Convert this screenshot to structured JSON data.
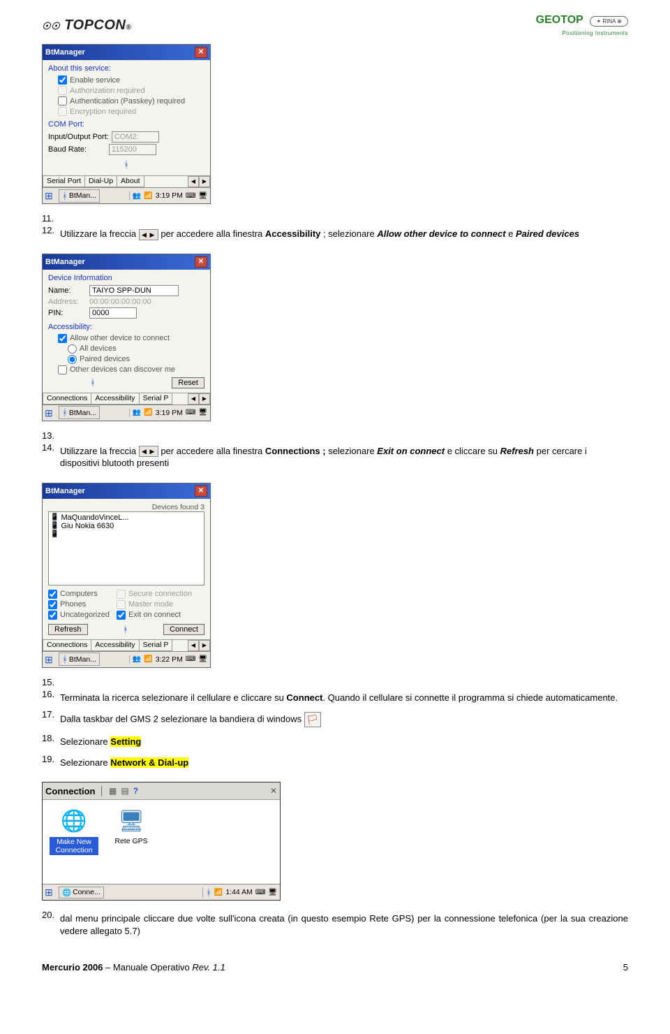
{
  "header": {
    "left_logo": "TOPCON",
    "right_logo": "GEOTOP",
    "right_sub": "Positioning Instruments",
    "cert": "RINA"
  },
  "step11": {
    "num": "11.",
    "dialog": {
      "title": "BtManager",
      "section": "About this service:",
      "chk_enable": "Enable service",
      "chk_auth_req": "Authorization required",
      "chk_passkey": "Authentication (Passkey) required",
      "chk_encrypt": "Encryption required",
      "com_port": "COM Port:",
      "io_port_label": "Input/Output Port:",
      "io_port_val": "COM2:",
      "baud_label": "Baud Rate:",
      "baud_val": "115200",
      "tab1": "Serial Port",
      "tab2": "Dial-Up",
      "tab3": "About",
      "task_btman": "BtMan...",
      "time": "3:19 PM"
    }
  },
  "step12": {
    "num": "12.",
    "text_a": "Utilizzare la freccia ",
    "text_b": " per accedere alla finestra ",
    "bold1": "Accessibility",
    "text_c": " ; selezionare ",
    "ital1": "Allow other device to connect",
    "text_d": " e ",
    "ital2": "Paired devices"
  },
  "step13": {
    "num": "13.",
    "dialog": {
      "title": "BtManager",
      "section": "Device Information",
      "name_label": "Name:",
      "name_val": "TAIYO SPP-DUN",
      "addr_label": "Address:",
      "addr_val": "00:00:00:00:00:00",
      "pin_label": "PIN:",
      "pin_val": "0000",
      "access_label": "Accessibility:",
      "chk_allow": "Allow other device to connect",
      "rad_all": "All devices",
      "rad_paired": "Paired devices",
      "chk_discover": "Other devices can discover me",
      "btn_reset": "Reset",
      "tab1": "Connections",
      "tab2": "Accessibility",
      "tab3": "Serial P",
      "task_btman": "BtMan...",
      "time": "3:19 PM"
    }
  },
  "step14": {
    "num": "14.",
    "text_a": "Utilizzare la freccia ",
    "text_b": " per accedere alla finestra ",
    "bold1": "Connections ;",
    "text_c": " selezionare ",
    "ital1": "Exit on connect",
    "text_d": " e cliccare su ",
    "ital2": "Refresh",
    "text_e": " per cercare i dispositivi blutooth presenti"
  },
  "step15": {
    "num": "15.",
    "dialog": {
      "title": "BtManager",
      "found_label": "Devices found 3",
      "dev1": "MaQuandoVinceL...",
      "dev2": "Giu Nokia 6630",
      "chk_computers": "Computers",
      "chk_phones": "Phones",
      "chk_uncat": "Uncategorized",
      "chk_secure": "Secure connection",
      "chk_master": "Master mode",
      "chk_exit": "Exit on connect",
      "btn_refresh": "Refresh",
      "btn_connect": "Connect",
      "tab1": "Connections",
      "tab2": "Accessibility",
      "tab3": "Serial P",
      "task_btman": "BtMan...",
      "time": "3:22 PM"
    }
  },
  "step16": {
    "num": "16.",
    "text_a": "Terminata la ricerca selezionare il cellulare e cliccare su ",
    "bold1": "Connect",
    "text_b": ". Quando il cellulare si connette il programma si chiede automaticamente."
  },
  "step17": {
    "num": "17.",
    "text": "Dalla taskbar del GMS 2 selezionare la bandiera di windows "
  },
  "step18": {
    "num": "18.",
    "text_a": "Selezionare ",
    "hl": "Setting"
  },
  "step19": {
    "num": "19.",
    "text_a": "Selezionare ",
    "hl": "Network & Dial-up",
    "conn_win": {
      "title": "Connection",
      "item1": "Make New Connection",
      "item2": "Rete GPS",
      "task": "Conne...",
      "time": "1:44 AM"
    }
  },
  "step20": {
    "num": "20.",
    "text": "dal menu principale cliccare due volte sull'icona creata (in questo esempio Rete GPS) per la connessione telefonica (per la sua creazione vedere allegato 5.7)"
  },
  "footer": {
    "left_bold": "Mercurio 2006",
    "left_rest": " – Manuale Operativo ",
    "rev": "Rev. 1.1",
    "page": "5"
  }
}
